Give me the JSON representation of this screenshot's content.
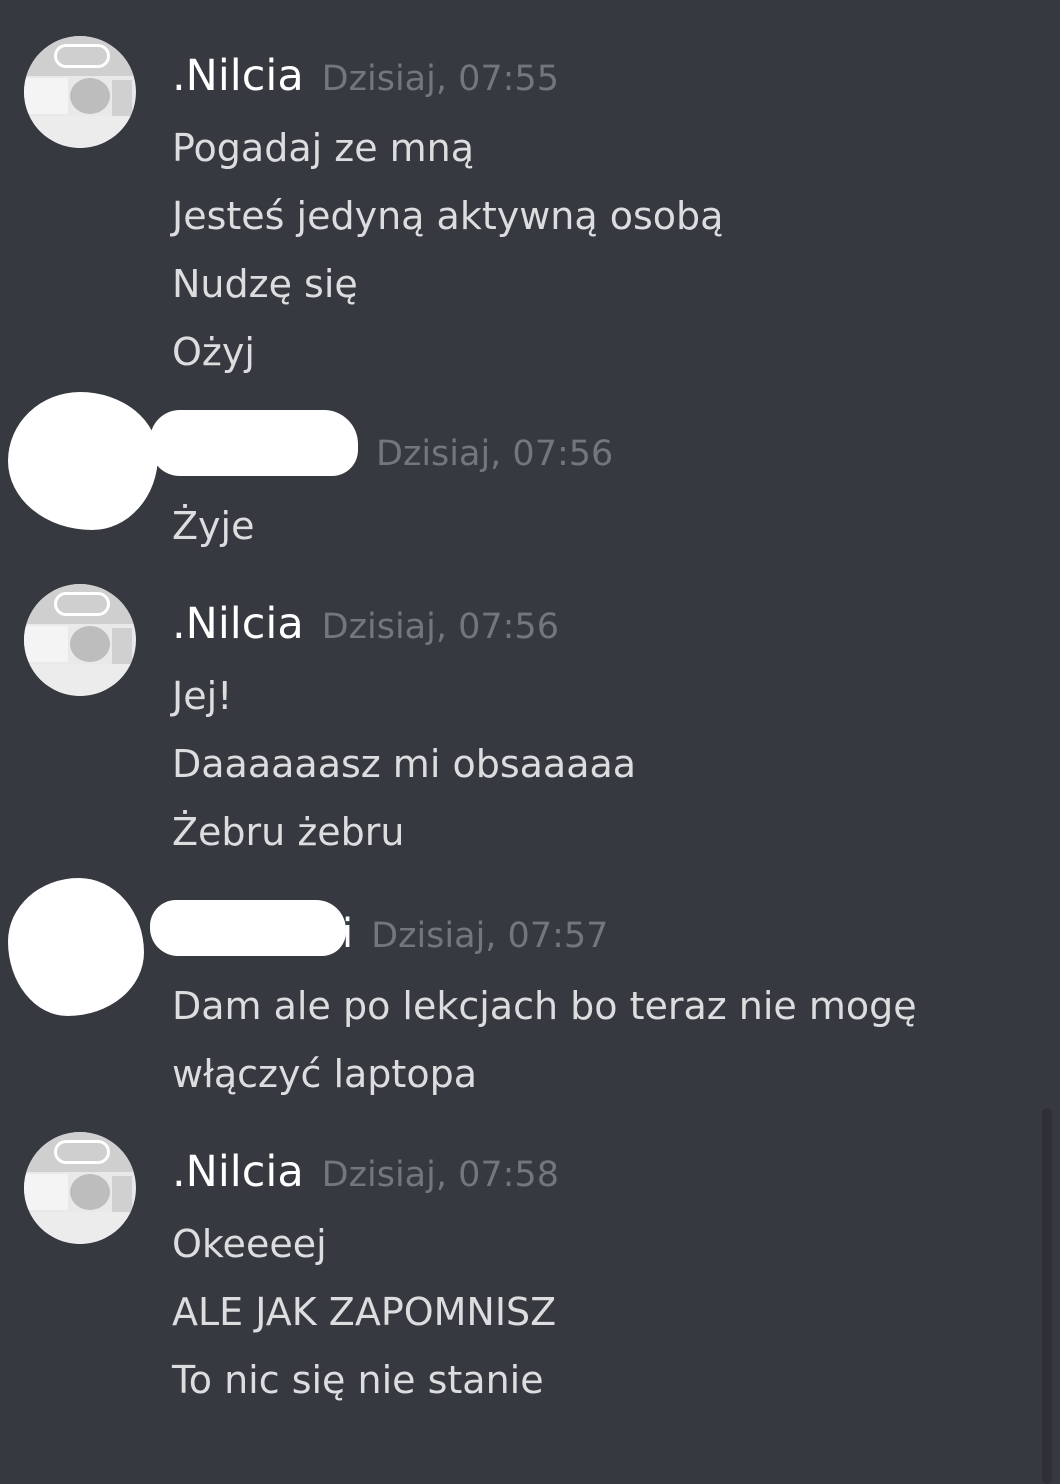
{
  "messages": [
    {
      "author": ".Nilcia",
      "timestamp": "Dzisiaj, 07:55",
      "lines": [
        "Pogadaj ze mną",
        "Jesteś jedyną aktywną osobą",
        "Nudzę się",
        "Ożyj"
      ]
    },
    {
      "author": "",
      "timestamp": "Dzisiaj, 07:56",
      "lines": [
        "Żyje"
      ]
    },
    {
      "author": ".Nilcia",
      "timestamp": "Dzisiaj, 07:56",
      "lines": [
        "Jej!",
        "Daaaaaasz mi obsaaaaa",
        "Żebru żebru"
      ]
    },
    {
      "author": "i",
      "timestamp": "Dzisiaj, 07:57",
      "lines": [
        "Dam ale po lekcjach bo teraz nie mogę",
        "włączyć laptopa"
      ]
    },
    {
      "author": ".Nilcia",
      "timestamp": "Dzisiaj, 07:58",
      "lines": [
        "Okeeeej",
        "ALE JAK ZAPOMNISZ",
        "To nic się nie stanie"
      ]
    }
  ],
  "colors": {
    "background": "#36393f",
    "username": "#ffffff",
    "timestamp": "#72767d",
    "message_text": "#dcddde"
  }
}
